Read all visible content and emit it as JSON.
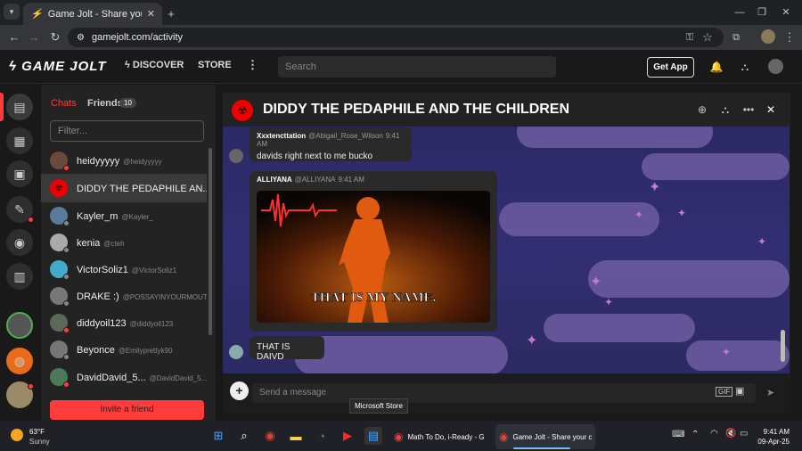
{
  "browser": {
    "tab_title": "Game Jolt - Share your creatio",
    "url": "gamejolt.com/activity"
  },
  "header": {
    "logo": "GAME JOLT",
    "nav_discover": "DISCOVER",
    "nav_store": "STORE",
    "search_placeholder": "Search",
    "get_app": "Get App"
  },
  "chat_sidebar": {
    "tab_chats": "Chats",
    "tab_friends": "Friends",
    "friends_count": "10",
    "filter_placeholder": "Filter...",
    "items": [
      {
        "name": "heidyyyyy",
        "username": "@heidyyyyy",
        "status": "red"
      },
      {
        "name": "DIDDY THE PEDAPHILE AN...",
        "username": "",
        "status": ""
      },
      {
        "name": "Kayler_m",
        "username": "@Kayler_",
        "status": "grey"
      },
      {
        "name": "kenia",
        "username": "@cteh",
        "status": "grey"
      },
      {
        "name": "VictorSoliz1",
        "username": "@VictorSoliz1",
        "status": "grey"
      },
      {
        "name": "DRAKE :)",
        "username": "@POSSAYINYOURMOUTH",
        "status": "grey"
      },
      {
        "name": "diddyoil123",
        "username": "@diddyoil123",
        "status": "red"
      },
      {
        "name": "Beyonce",
        "username": "@Emilyprettyk90",
        "status": "grey"
      },
      {
        "name": "DavidDavid_5...",
        "username": "@DavidDavid_5...",
        "status": "red"
      }
    ],
    "invite_button": "Invite a friend"
  },
  "chat": {
    "room_title": "DIDDY THE PEDAPHILE AND THE CHILDREN",
    "messages": [
      {
        "author": "Xxxtencttation",
        "handle": "@Abigail_Rose_Wilson",
        "time": "9:41 AM",
        "text": "davids right next to me bucko"
      },
      {
        "author": "ALLIYANA",
        "handle": "@ALLIYANA",
        "time": "9:41 AM",
        "gif_caption": "THAT IS MY NAME."
      },
      {
        "author": "",
        "handle": "",
        "time": "",
        "text": "THAT IS DAIVD"
      }
    ],
    "input_placeholder": "Send a message"
  },
  "tooltip": "Microsoft Store",
  "taskbar": {
    "weather_temp": "63°F",
    "weather_desc": "Sunny",
    "app1_label": "Math To Do, i-Ready - G",
    "app2_label": "Game Jolt - Share your c",
    "time": "9:41 AM",
    "date": "09-Apr-25"
  },
  "colors": {
    "accent": "#ff3b3b",
    "bg": "#191919"
  }
}
